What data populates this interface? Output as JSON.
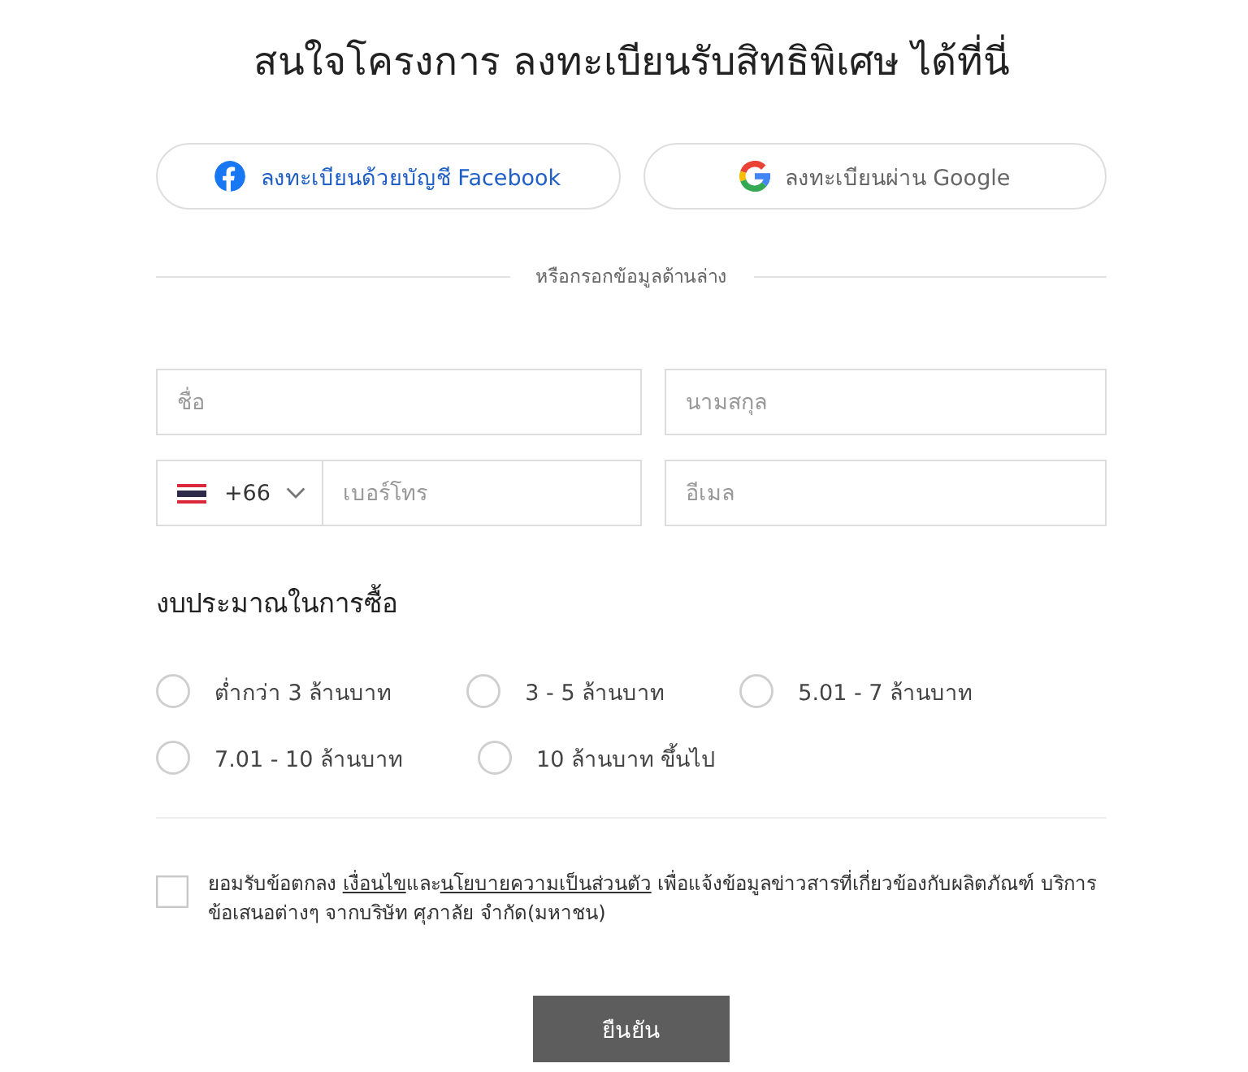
{
  "title": "สนใจโครงการ ลงทะเบียนรับสิทธิพิเศษ ได้ที่นี่",
  "social_buttons": [
    {
      "kind": "facebook",
      "label": "ลงทะเบียนด้วยบัญชี Facebook"
    },
    {
      "kind": "google",
      "label": "ลงทะเบียนผ่าน Google"
    }
  ],
  "divider_label": "หรือกรอกข้อมูลด้านล่าง",
  "fields": [
    {
      "kind": "text",
      "placeholder": "ชื่อ"
    },
    {
      "kind": "text",
      "placeholder": "นามสกุล"
    },
    {
      "kind": "phone",
      "country_code": "+66",
      "placeholder": "เบอร์โทร"
    },
    {
      "kind": "text",
      "placeholder": "อีเมล"
    }
  ],
  "budget": {
    "heading": "งบประมาณในการซื้อ",
    "options": [
      {
        "label": "ต่ำกว่า 3 ล้านบาท",
        "selected": false
      },
      {
        "label": "3 - 5 ล้านบาท",
        "selected": false
      },
      {
        "label": "5.01 - 7 ล้านบาท",
        "selected": false
      },
      {
        "label": "7.01 - 10 ล้านบาท",
        "selected": false
      },
      {
        "label": "10 ล้านบาท ขึ้นไป",
        "selected": false
      }
    ]
  },
  "consent": {
    "checked": false,
    "parts": [
      {
        "kind": "text",
        "text": "ยอมรับข้อตกลง "
      },
      {
        "kind": "link",
        "text": "เงื่อนไข"
      },
      {
        "kind": "text",
        "text": "และ"
      },
      {
        "kind": "link",
        "text": "นโยบายความเป็นส่วนตัว"
      },
      {
        "kind": "text",
        "text": " เพื่อแจ้งข้อมูลข่าวสารที่เกี่ยวข้องกับผลิตภัณฑ์ บริการ ข้อเสนอต่างๆ จากบริษัท ศุภาลัย จำกัด(มหาชน)"
      }
    ]
  },
  "submit": {
    "label": "ยืนยัน"
  }
}
